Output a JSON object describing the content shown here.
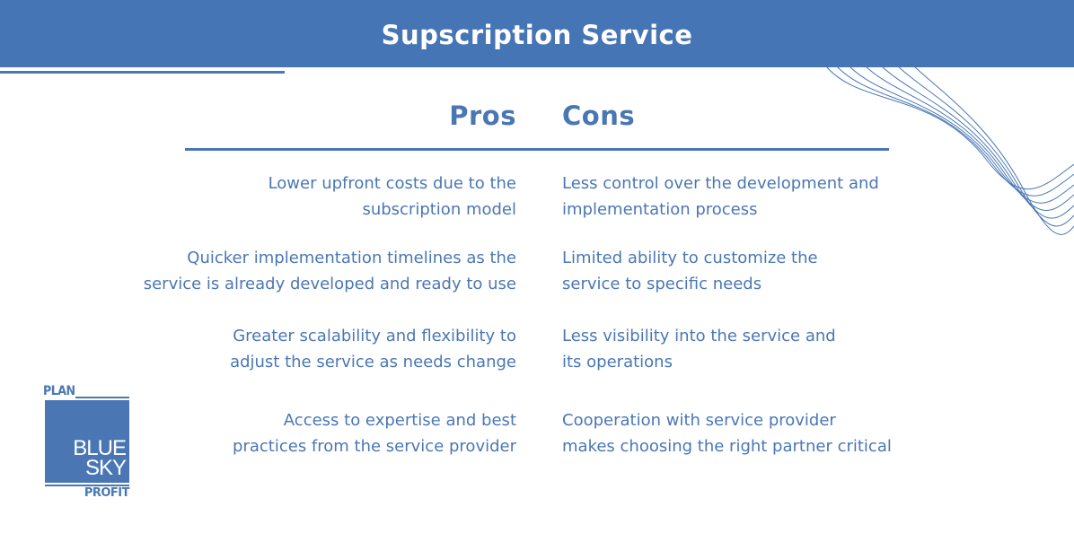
{
  "header": {
    "title": "Supscription Service"
  },
  "columns": {
    "pros_label": "Pros",
    "cons_label": "Cons"
  },
  "pros": [
    "Lower upfront costs due to the\nsubscription model",
    "Quicker implementation timelines as the\nservice is already developed and ready to use",
    "Greater scalability and flexibility to\nadjust the service as needs change",
    "Access to expertise and best\npractices from the service provider"
  ],
  "cons": [
    "Less control over the development and\nimplementation process",
    "Limited ability to customize the\nservice to specific needs",
    "Less visibility into the service and\nits operations",
    "Cooperation with service provider\nmakes choosing the right partner critical"
  ],
  "logo": {
    "plan": "PLAN",
    "blue": "BLUE",
    "sky": "SKY",
    "profit": "PROFIT"
  },
  "colors": {
    "brand": "#4575b4",
    "text": "#4a77b4",
    "background": "#ffffff"
  }
}
